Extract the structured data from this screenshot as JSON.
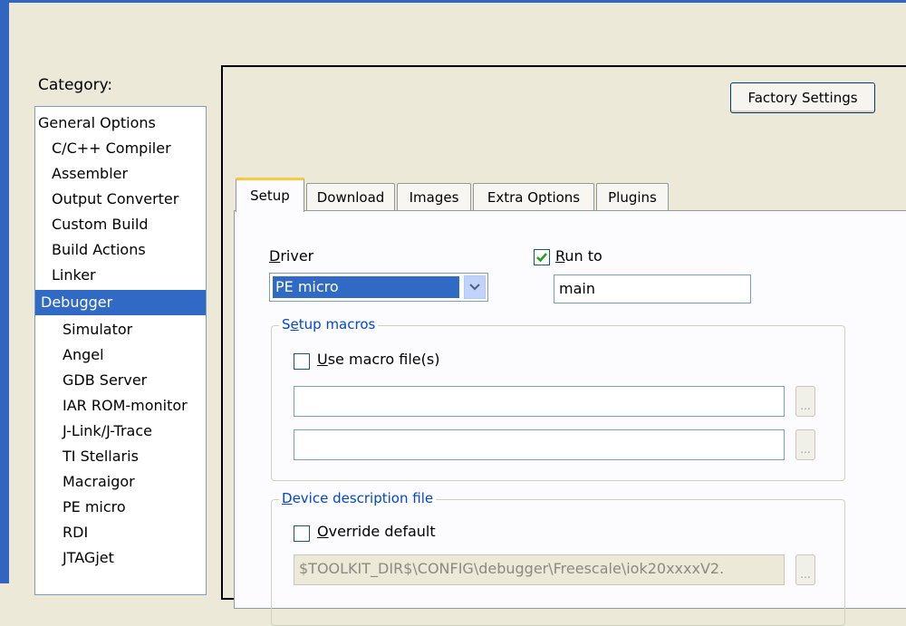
{
  "colors": {
    "accent": "#316ac5",
    "group_title": "#0046d5",
    "active_tab_highlight": "#ffc83c"
  },
  "category": {
    "label": "Category:",
    "items": [
      "General Options",
      "C/C++ Compiler",
      "Assembler",
      "Output Converter",
      "Custom Build",
      "Build Actions",
      "Linker",
      "Debugger",
      "Simulator",
      "Angel",
      "GDB Server",
      "IAR ROM-monitor",
      "J-Link/J-Trace",
      "TI Stellaris",
      "Macraigor",
      "PE micro",
      "RDI",
      "JTAGjet"
    ],
    "selected": "Debugger"
  },
  "toolbar": {
    "factory_settings": "Factory Settings"
  },
  "tabs": [
    "Setup",
    "Download",
    "Images",
    "Extra Options",
    "Plugins"
  ],
  "active_tab": "Setup",
  "setup": {
    "driver_label_u": "D",
    "driver_label_rest": "river",
    "driver_value": "PE micro",
    "run_to_checked": true,
    "run_to_label_u": "R",
    "run_to_label_rest": "un to",
    "run_to_value": "main",
    "setup_macros": {
      "title_pre": "S",
      "title_u": "e",
      "title_rest": "tup macros",
      "use_macro_u": "U",
      "use_macro_rest": "se macro file(s)",
      "use_macro_checked": false,
      "browse_label": "..."
    },
    "device_description": {
      "title_pre": "",
      "title_u": "D",
      "title_rest": "evice description file",
      "override_u": "O",
      "override_rest": "verride default",
      "override_checked": false,
      "path": "$TOOLKIT_DIR$\\CONFIG\\debugger\\Freescale\\iok20xxxxV2.",
      "browse_label": "..."
    }
  }
}
